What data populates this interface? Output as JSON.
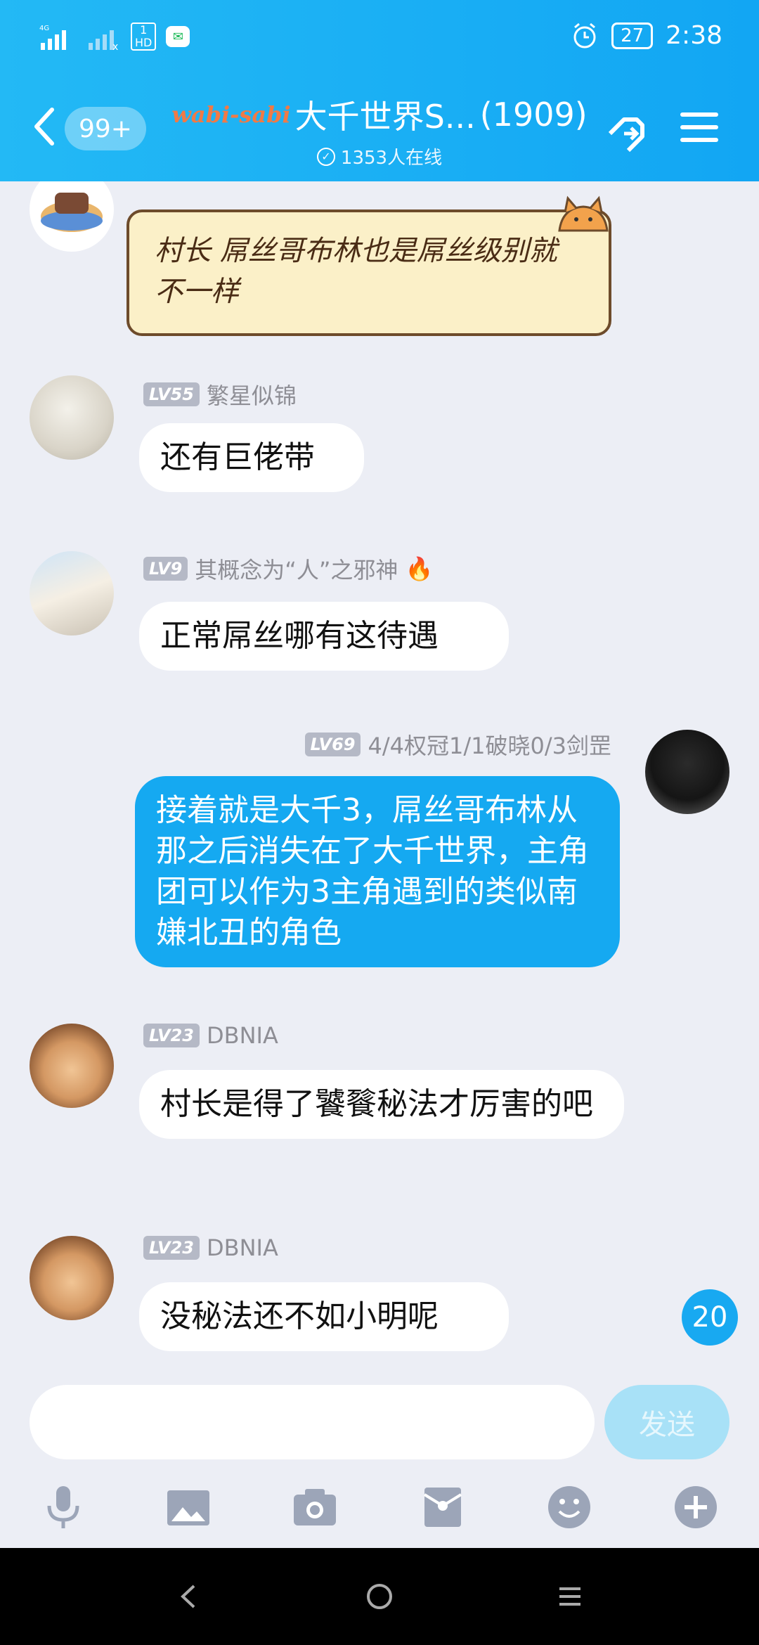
{
  "status_bar": {
    "network": "4G",
    "sim2": "1\nHD",
    "battery": "27",
    "time": "2:38"
  },
  "header": {
    "unread_badge": "99+",
    "group_prefix": "wabi-sabi",
    "group_name": "大千世界S...",
    "member_count": "(1909)",
    "online": "1353人在线"
  },
  "messages": [
    {
      "kind": "note",
      "text": "村长 屌丝哥布林也是屌丝级别就不一样"
    },
    {
      "kind": "incoming",
      "level": "LV55",
      "name": "繁星似锦",
      "text": "还有巨佬带"
    },
    {
      "kind": "incoming",
      "level": "LV9",
      "name": "其概念为“人”之邪神",
      "text": "正常屌丝哪有这待遇"
    },
    {
      "kind": "outgoing",
      "level": "LV69",
      "name": "4/4权冠1/1破晓0/3剑罡",
      "text": "接着就是大千3，屌丝哥布林从那之后消失在了大千世界，主角团可以作为3主角遇到的类似南嫌北丑的角色"
    },
    {
      "kind": "incoming",
      "level": "LV23",
      "name": "DBNIA",
      "text": "村长是得了饕餮秘法才厉害的吧"
    },
    {
      "kind": "incoming",
      "level": "LV23",
      "name": "DBNIA",
      "text": "没秘法还不如小明呢"
    }
  ],
  "unread_count": "20",
  "composer": {
    "placeholder": "",
    "send_label": "发送"
  },
  "toolbar": [
    "mic-icon",
    "image-icon",
    "camera-icon",
    "redpacket-icon",
    "emoji-icon",
    "plus-icon"
  ],
  "colors": {
    "header": "#1aaef4",
    "outgoing_bubble": "#15a9f1",
    "background": "#eceef5"
  }
}
